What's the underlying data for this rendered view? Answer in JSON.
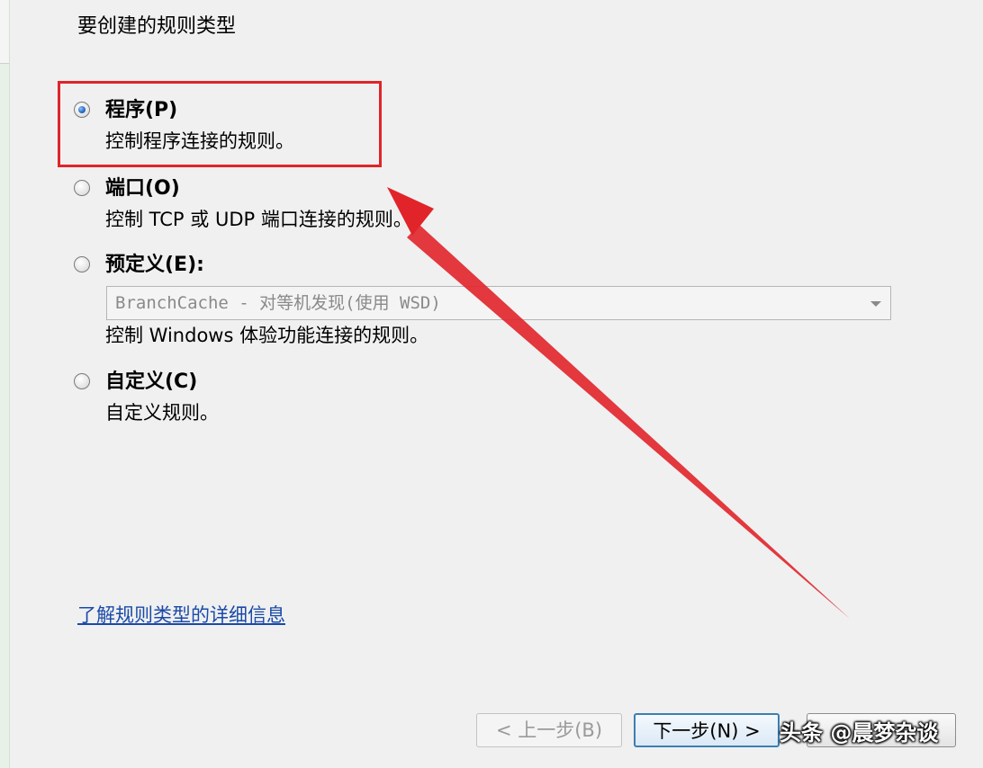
{
  "section_title": "要创建的规则类型",
  "options": [
    {
      "label": "程序(P)",
      "description": "控制程序连接的规则。",
      "selected": true
    },
    {
      "label": "端口(O)",
      "description": "控制 TCP 或 UDP 端口连接的规则。",
      "selected": false
    },
    {
      "label": "预定义(E):",
      "description": "控制 Windows 体验功能连接的规则。",
      "selected": false
    },
    {
      "label": "自定义(C)",
      "description": "自定义规则。",
      "selected": false
    }
  ],
  "predefined_select": {
    "value": "BranchCache - 对等机发现(使用 WSD)",
    "enabled": false
  },
  "learn_more_link": "了解规则类型的详细信息",
  "buttons": {
    "back": "< 上一步(B)",
    "next": "下一步(N) >",
    "cancel": ""
  },
  "watermark": "头条 @晨梦杂谈",
  "colors": {
    "annotation_red": "#e0242a",
    "link_blue": "#1a4aa8",
    "next_button_border": "#3c7fb1"
  },
  "icons": {
    "radio_selected": "radio-selected-icon",
    "radio_unselected": "radio-unselected-icon",
    "dropdown": "chevron-down-icon",
    "annotation_arrow": "red-arrow-icon"
  }
}
